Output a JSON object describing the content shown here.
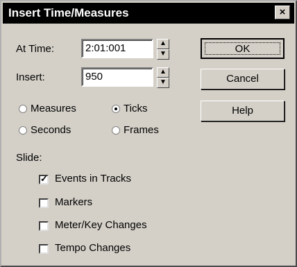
{
  "window": {
    "title": "Insert Time/Measures",
    "close_glyph": "×"
  },
  "at_time": {
    "label": "At Time:",
    "value": "2:01:001"
  },
  "insert": {
    "label": "Insert:",
    "value": "950"
  },
  "buttons": {
    "ok": "OK",
    "cancel": "Cancel",
    "help": "Help"
  },
  "units": {
    "measures": "Measures",
    "ticks": "Ticks",
    "seconds": "Seconds",
    "frames": "Frames",
    "selected": "ticks"
  },
  "slide": {
    "label": "Slide:",
    "items": [
      {
        "label": "Events in Tracks",
        "checked": true
      },
      {
        "label": "Markers",
        "checked": false
      },
      {
        "label": "Meter/Key Changes",
        "checked": false
      },
      {
        "label": "Tempo Changes",
        "checked": false
      }
    ]
  }
}
